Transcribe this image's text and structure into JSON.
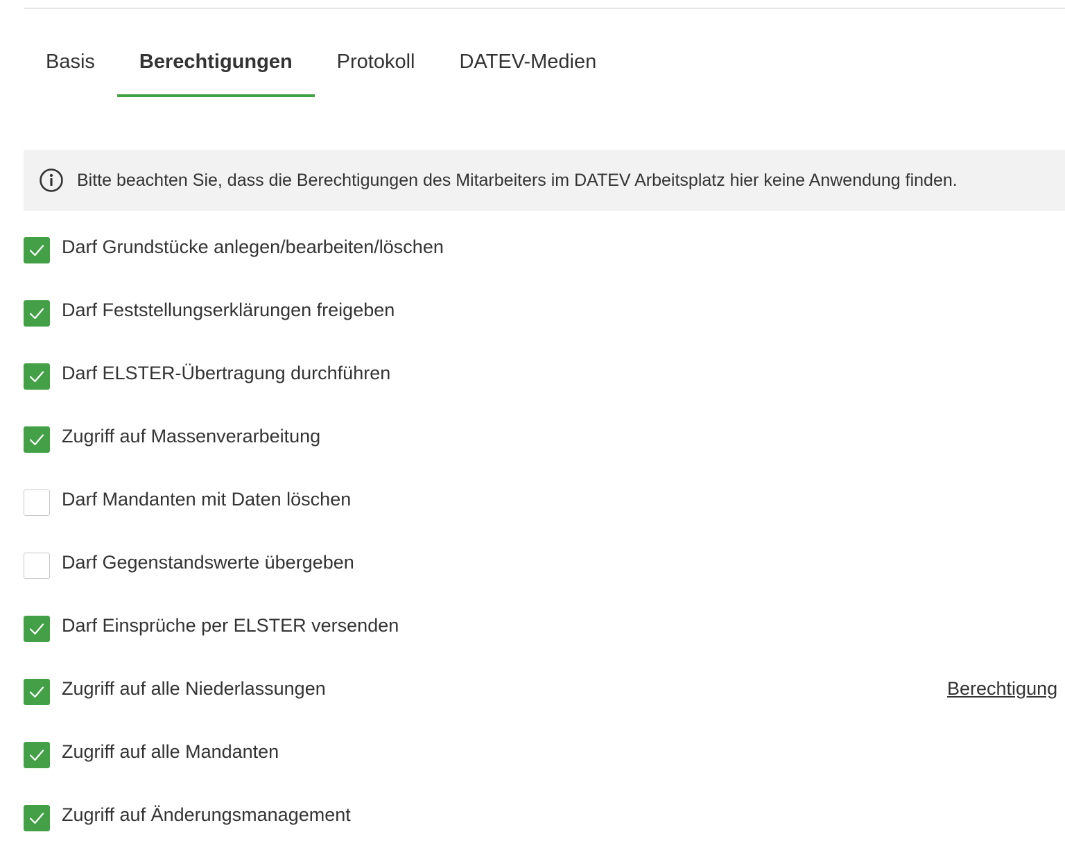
{
  "tabs": [
    {
      "label": "Basis",
      "active": false
    },
    {
      "label": "Berechtigungen",
      "active": true
    },
    {
      "label": "Protokoll",
      "active": false
    },
    {
      "label": "DATEV-Medien",
      "active": false
    }
  ],
  "info_banner": {
    "icon": "info-circle-icon",
    "text": "Bitte beachten Sie, dass die Berechtigungen des Mitarbeiters im DATEV Arbeitsplatz hier keine Anwendung finden."
  },
  "permissions": [
    {
      "label": "Darf Grundstücke anlegen/bearbeiten/löschen",
      "checked": true
    },
    {
      "label": "Darf Feststellungserklärungen freigeben",
      "checked": true
    },
    {
      "label": "Darf ELSTER-Übertragung durchführen",
      "checked": true
    },
    {
      "label": "Zugriff auf Massenverarbeitung",
      "checked": true
    },
    {
      "label": "Darf Mandanten mit Daten löschen",
      "checked": false
    },
    {
      "label": "Darf Gegenstandswerte übergeben",
      "checked": false
    },
    {
      "label": "Darf Einsprüche per ELSTER versenden",
      "checked": true
    },
    {
      "label": "Zugriff auf alle Niederlassungen",
      "checked": true,
      "link": "Berechtigung"
    },
    {
      "label": "Zugriff auf alle Mandanten",
      "checked": true
    },
    {
      "label": "Zugriff auf Änderungsmanagement",
      "checked": true
    }
  ],
  "colors": {
    "accent": "#43a047",
    "banner_bg": "#f2f2f2",
    "text": "#333333"
  }
}
